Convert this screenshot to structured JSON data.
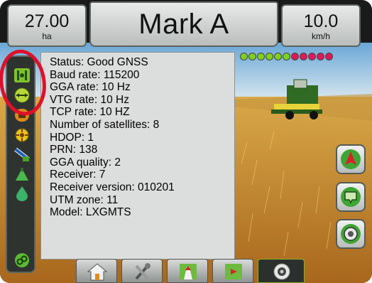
{
  "header": {
    "area": {
      "value": "27.00",
      "unit": "ha"
    },
    "title": "Mark A",
    "speed": {
      "value": "10.0",
      "unit": "km/h"
    }
  },
  "status_panel": {
    "lines": [
      "Status: Good GNSS",
      "Baud rate:  115200",
      "GGA rate: 10 Hz",
      "VTG rate: 10 Hz",
      "TCP rate: 10 HZ",
      "Number of satellites: 8",
      "HDOP: 1",
      "PRN: 138",
      "GGA quality: 2",
      "Receiver: 7",
      "Receiver version: 010201",
      "UTM zone: 11",
      "Model: LXGMTS"
    ]
  },
  "leds": {
    "colors": [
      "#7fd11e",
      "#7fd11e",
      "#7fd11e",
      "#7fd11e",
      "#7fd11e",
      "#7fd11e",
      "#e0185a",
      "#e0185a",
      "#e0185a",
      "#e0185a",
      "#e0185a"
    ]
  },
  "left_toolbar": {
    "icons": [
      "boom-section-icon",
      "lightbar-icon",
      "guidance-mode-icon",
      "boomsteer-icon",
      "tilt-icon",
      "sprayer-icon",
      "product-drop-icon",
      "link-icon"
    ]
  },
  "right_buttons": [
    "north-arrow-icon",
    "map-icon",
    "gnss-status-icon"
  ],
  "bottom_tabs": [
    "home-icon",
    "tools-icon",
    "vehicle-view-icon",
    "field-map-icon",
    "gnss-settings-icon"
  ],
  "colors": {
    "accent_green": "#8ab02a",
    "annotation_red": "#e0102a"
  }
}
